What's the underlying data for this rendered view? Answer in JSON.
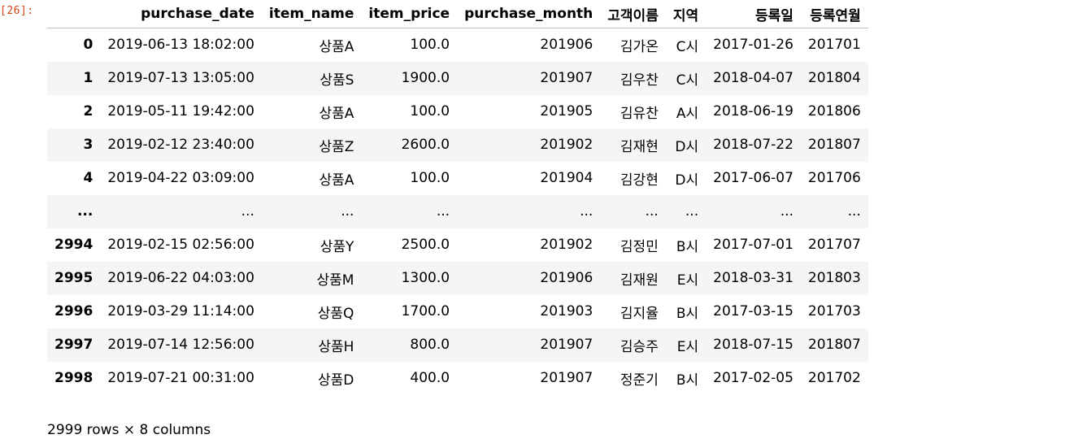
{
  "cell": {
    "prompt": "[26]:"
  },
  "table": {
    "index_header": "",
    "columns": [
      "purchase_date",
      "item_name",
      "item_price",
      "purchase_month",
      "고객이름",
      "지역",
      "등록일",
      "등록연월"
    ],
    "rows": [
      {
        "index": "0",
        "cells": [
          "2019-06-13 18:02:00",
          "상품A",
          "100.0",
          "201906",
          "김가온",
          "C시",
          "2017-01-26",
          "201701"
        ]
      },
      {
        "index": "1",
        "cells": [
          "2019-07-13 13:05:00",
          "상품S",
          "1900.0",
          "201907",
          "김우찬",
          "C시",
          "2018-04-07",
          "201804"
        ]
      },
      {
        "index": "2",
        "cells": [
          "2019-05-11 19:42:00",
          "상품A",
          "100.0",
          "201905",
          "김유찬",
          "A시",
          "2018-06-19",
          "201806"
        ]
      },
      {
        "index": "3",
        "cells": [
          "2019-02-12 23:40:00",
          "상품Z",
          "2600.0",
          "201902",
          "김재현",
          "D시",
          "2018-07-22",
          "201807"
        ]
      },
      {
        "index": "4",
        "cells": [
          "2019-04-22 03:09:00",
          "상품A",
          "100.0",
          "201904",
          "김강현",
          "D시",
          "2017-06-07",
          "201706"
        ]
      },
      {
        "index": "...",
        "cells": [
          "...",
          "...",
          "...",
          "...",
          "...",
          "...",
          "...",
          "..."
        ]
      },
      {
        "index": "2994",
        "cells": [
          "2019-02-15 02:56:00",
          "상품Y",
          "2500.0",
          "201902",
          "김정민",
          "B시",
          "2017-07-01",
          "201707"
        ]
      },
      {
        "index": "2995",
        "cells": [
          "2019-06-22 04:03:00",
          "상품M",
          "1300.0",
          "201906",
          "김재원",
          "E시",
          "2018-03-31",
          "201803"
        ]
      },
      {
        "index": "2996",
        "cells": [
          "2019-03-29 11:14:00",
          "상품Q",
          "1700.0",
          "201903",
          "김지율",
          "B시",
          "2017-03-15",
          "201703"
        ]
      },
      {
        "index": "2997",
        "cells": [
          "2019-07-14 12:56:00",
          "상품H",
          "800.0",
          "201907",
          "김승주",
          "E시",
          "2018-07-15",
          "201807"
        ]
      },
      {
        "index": "2998",
        "cells": [
          "2019-07-21 00:31:00",
          "상품D",
          "400.0",
          "201907",
          "정준기",
          "B시",
          "2017-02-05",
          "201702"
        ]
      }
    ]
  },
  "shape_info": "2999 rows × 8 columns",
  "colors": {
    "prompt": "#d84315",
    "stripe": "#f5f5f5",
    "header_border": "#bdbdbd"
  }
}
